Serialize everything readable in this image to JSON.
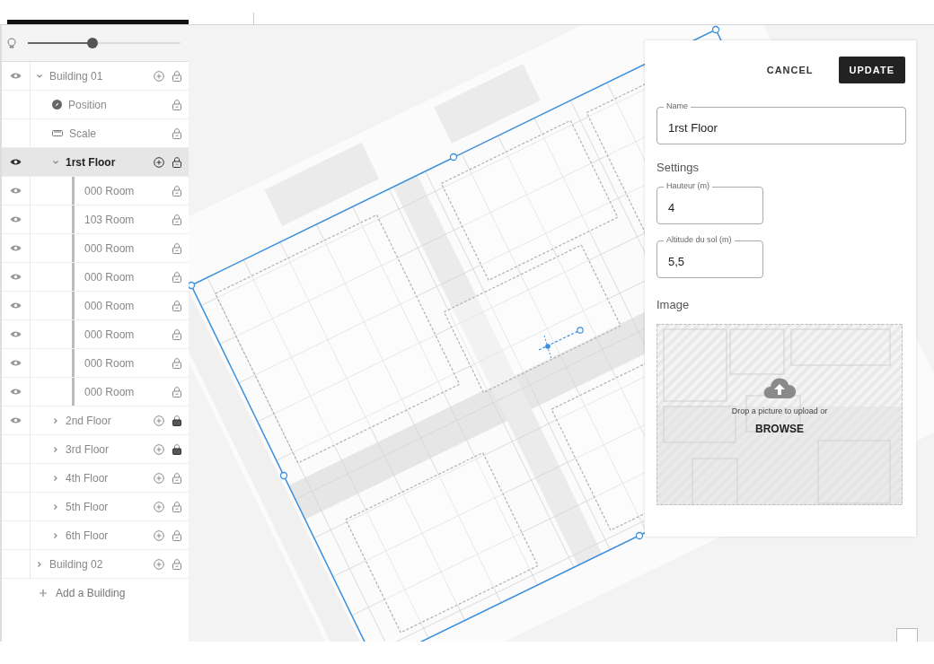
{
  "opacity_slider": {
    "level": 0.41
  },
  "tree": {
    "items": [
      {
        "kind": "building",
        "label": "Building 01",
        "visible": true,
        "expanded": true,
        "locked": false,
        "selected": false,
        "children": [
          {
            "kind": "position",
            "label": "Position",
            "visible": false,
            "locked": false,
            "selected": false
          },
          {
            "kind": "scale",
            "label": "Scale",
            "visible": false,
            "locked": false,
            "selected": false
          },
          {
            "kind": "floor",
            "label": "1rst Floor",
            "visible": true,
            "expanded": true,
            "locked": false,
            "selected": true,
            "children": [
              {
                "kind": "room",
                "label": "000 Room",
                "visible": true,
                "locked": false,
                "selected": false
              },
              {
                "kind": "room",
                "label": "103 Room",
                "visible": true,
                "locked": false,
                "selected": false
              },
              {
                "kind": "room",
                "label": "000 Room",
                "visible": true,
                "locked": false,
                "selected": false
              },
              {
                "kind": "room",
                "label": "000 Room",
                "visible": true,
                "locked": false,
                "selected": false
              },
              {
                "kind": "room",
                "label": "000 Room",
                "visible": true,
                "locked": false,
                "selected": false
              },
              {
                "kind": "room",
                "label": "000 Room",
                "visible": true,
                "locked": false,
                "selected": false
              },
              {
                "kind": "room",
                "label": "000 Room",
                "visible": true,
                "locked": false,
                "selected": false
              },
              {
                "kind": "room",
                "label": "000 Room",
                "visible": true,
                "locked": false,
                "selected": false
              }
            ]
          },
          {
            "kind": "floor",
            "label": "2nd Floor",
            "visible": true,
            "expanded": false,
            "locked": true,
            "selected": false
          },
          {
            "kind": "floor",
            "label": "3rd Floor",
            "visible": false,
            "expanded": false,
            "locked": true,
            "selected": false
          },
          {
            "kind": "floor",
            "label": "4th Floor",
            "visible": false,
            "expanded": false,
            "locked": false,
            "selected": false
          },
          {
            "kind": "floor",
            "label": "5th Floor",
            "visible": false,
            "expanded": false,
            "locked": false,
            "selected": false
          },
          {
            "kind": "floor",
            "label": "6th Floor",
            "visible": false,
            "expanded": false,
            "locked": false,
            "selected": false
          }
        ]
      },
      {
        "kind": "building",
        "label": "Building 02",
        "visible": false,
        "expanded": false,
        "locked": false,
        "selected": false
      }
    ],
    "add_label": "Add a Building"
  },
  "panel": {
    "buttons": [
      {
        "kind": "text",
        "label": "CANCEL"
      },
      {
        "kind": "primary",
        "label": "UPDATE"
      }
    ],
    "name_field": {
      "label": "Name",
      "value": "1rst Floor"
    },
    "settings_title": "Settings",
    "settings_fields": [
      {
        "label": "Hauteur (m)",
        "value": "4"
      },
      {
        "label": "Altitude du sol (m)",
        "value": "5,5"
      }
    ],
    "image_title": "Image",
    "dropzone": {
      "text": "Drop a picture to upload or",
      "browse": "BROWSE"
    }
  }
}
